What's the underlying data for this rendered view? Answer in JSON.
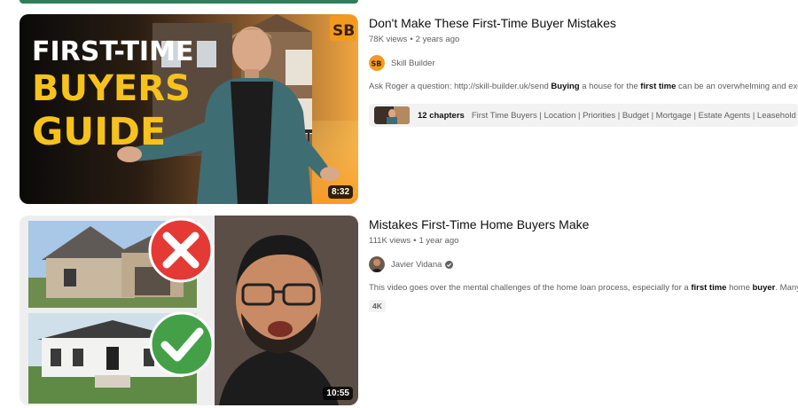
{
  "results": [
    {
      "title": "Don't Make These First-Time Buyer Mistakes",
      "views": "78K views",
      "age": "2 years ago",
      "channel": "Skill Builder",
      "channel_logo_text": "SB",
      "thumb_text_line1": "FIRST-TIME",
      "thumb_text_line2": "BUYERS",
      "thumb_text_line3": "GUIDE",
      "duration": "8:32",
      "description_parts": [
        {
          "t": "Ask Roger a question: http://skill-builder.uk/send ",
          "b": false
        },
        {
          "t": "Buying",
          "b": true
        },
        {
          "t": " a house for the ",
          "b": false
        },
        {
          "t": "first time",
          "b": true
        },
        {
          "t": " can be an overwhelming and exciting",
          "b": false
        }
      ],
      "chapters_count": "12 chapters",
      "chapters_list": "First Time Buyers | Location | Priorities | Budget | Mortgage | Estate Agents | Leasehold Prope"
    },
    {
      "title": "Mistakes First-Time Home Buyers Make",
      "views": "111K views",
      "age": "1 year ago",
      "channel": "Javier Vidana",
      "duration": "10:55",
      "description_parts": [
        {
          "t": "This video goes over the mental challenges of the home loan process, especially for a ",
          "b": false
        },
        {
          "t": "first time",
          "b": true
        },
        {
          "t": " home ",
          "b": false
        },
        {
          "t": "buyer",
          "b": true
        },
        {
          "t": ". Many enco",
          "b": false
        }
      ],
      "badge": "4K"
    }
  ],
  "colors": {
    "accent_yellow": "#f6c21c",
    "error_red": "#e53935",
    "check_green": "#43a047"
  }
}
